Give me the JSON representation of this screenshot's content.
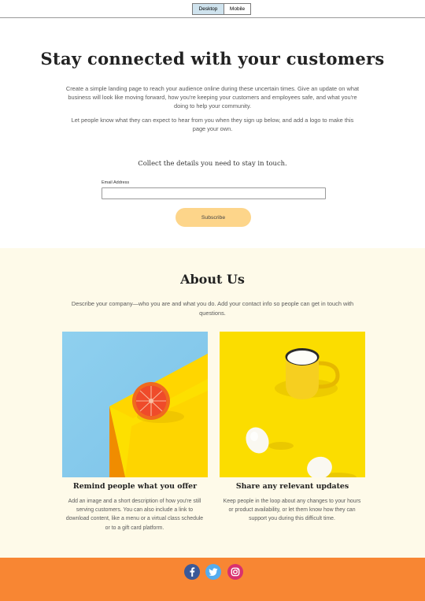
{
  "toggle": {
    "desktop": "Desktop",
    "mobile": "Mobile"
  },
  "hero": {
    "title": "Stay connected with your customers",
    "p1": "Create a simple landing page to reach your audience online during these uncertain times. Give an update on what business will look like moving forward, how you're keeping your customers and employees safe, and what you're doing to help your community.",
    "p2": "Let people know what they can expect to hear from you when they sign up below, and add a logo to make this page your own.",
    "collect": "Collect the details you need to stay in touch.",
    "email_label": "Email Address",
    "email_value": "",
    "subscribe_label": "Subscribe"
  },
  "about": {
    "title": "About Us",
    "description": "Describe your company—who you are and what you do. Add your contact info so people can get in touch with questions.",
    "cards": [
      {
        "title": "Remind people what you offer",
        "text": "Add an image and a short description of how you're still serving customers. You can also include a link to download content, like a menu or a virtual class schedule or to a gift card platform.",
        "image": "grapefruit-photo"
      },
      {
        "title": "Share any relevant updates",
        "text": "Keep people in the loop about any changes to your hours or product availability, or let them know how they can support you during this difficult time.",
        "image": "milk-mug-eggs-photo"
      }
    ]
  },
  "footer": {
    "social": [
      "facebook-icon",
      "twitter-icon",
      "instagram-icon"
    ]
  },
  "colors": {
    "accent_button": "#fdd58a",
    "about_bg": "#fefae9",
    "footer_bg": "#f88633",
    "facebook": "#3b5998",
    "twitter": "#55acee",
    "instagram": "#d9316e"
  }
}
